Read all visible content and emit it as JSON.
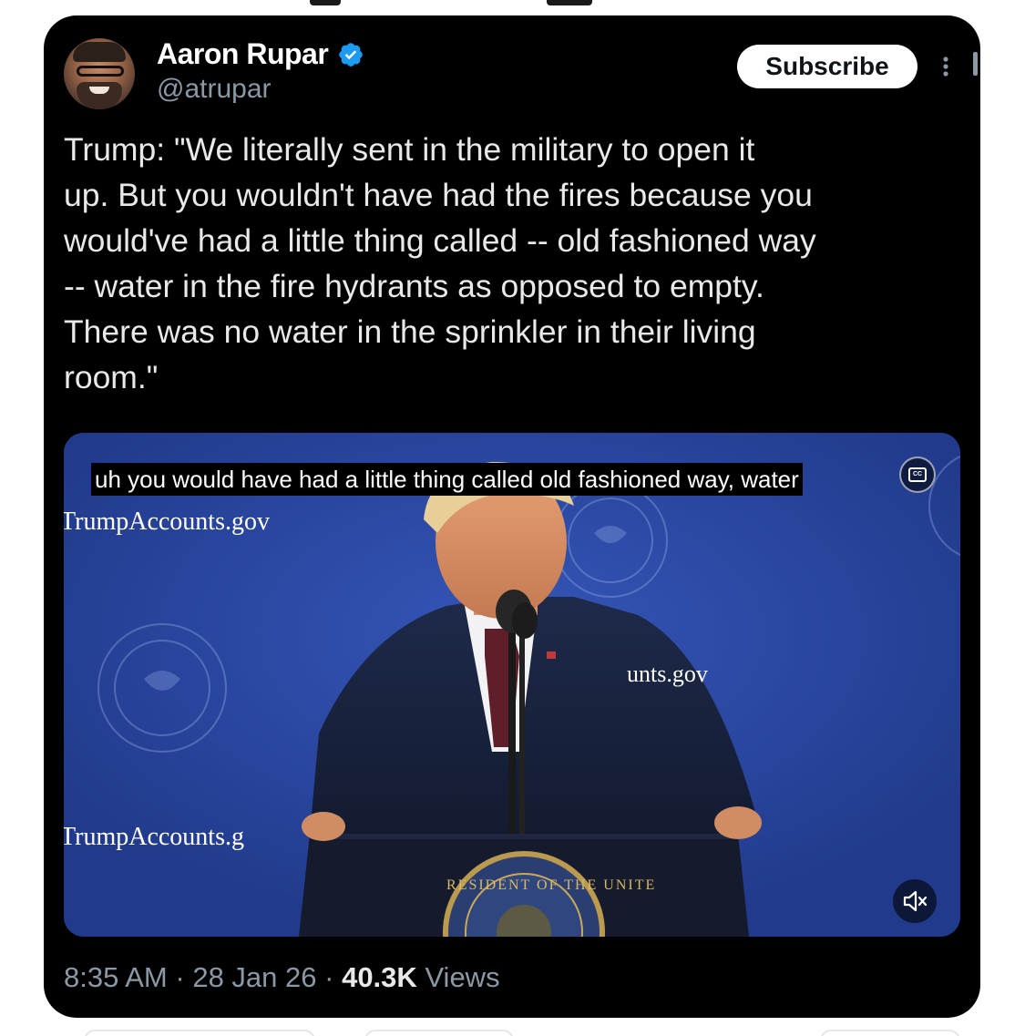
{
  "author": {
    "name": "Aaron Rupar",
    "handle": "@atrupar",
    "verified": true
  },
  "actions": {
    "subscribe_label": "Subscribe",
    "more_icon": "more-vertical-icon"
  },
  "tweet": {
    "text": "Trump: \"We literally sent in the military to open it\nup. But you wouldn't have had the fires because you\nwould've had a little thing called -- old fashioned way\n-- water in the fire hydrants as opposed to empty.\nThere was no water in the sprinkler in their living\nroom.\""
  },
  "video": {
    "caption": "uh you would have had a little thing called old fashioned way, water",
    "sign_texts": [
      "TrumpAccounts.gov",
      "unts.gov",
      "TrumpAccounts.g"
    ],
    "seal_text": "RESIDENT OF THE UNITE",
    "cc_icon": "closed-captions-icon",
    "mute_icon": "muted-speaker-icon"
  },
  "meta": {
    "time": "8:35 AM",
    "separator": "·",
    "date": "28 Jan 26",
    "views_count": "40.3K",
    "views_label": "Views"
  },
  "colors": {
    "card_bg": "#000000",
    "text_primary": "#e7e9ea",
    "text_secondary": "#8b98a5",
    "verified_blue": "#1d9bf0",
    "video_backdrop": "#2d4aa6"
  }
}
